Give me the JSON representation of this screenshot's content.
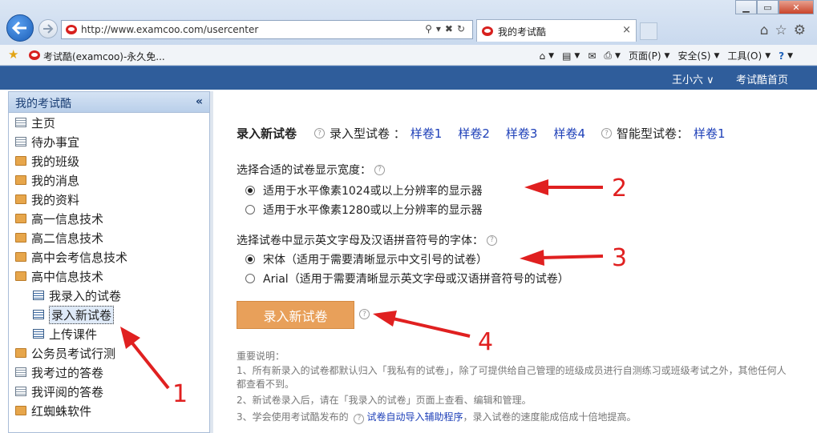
{
  "browser": {
    "url": "http://www.examcoo.com/usercenter",
    "tab_title": "我的考试酷",
    "tab_close": "×",
    "favorite_link": "考试酷(examcoo)-永久免...",
    "command_items": [
      {
        "label": "页面(P)"
      },
      {
        "label": "安全(S)"
      },
      {
        "label": "工具(O)"
      }
    ]
  },
  "header": {
    "user": "王小六 ∨",
    "home_link": "考试酷首页"
  },
  "sidebar": {
    "title": "我的考试酷",
    "collapse": "«",
    "items": [
      {
        "label": "主页",
        "icon": "page"
      },
      {
        "label": "待办事宜",
        "icon": "page"
      },
      {
        "label": "我的班级",
        "icon": "folder"
      },
      {
        "label": "我的消息",
        "icon": "folder"
      },
      {
        "label": "我的资料",
        "icon": "folder"
      },
      {
        "label": "高一信息技术",
        "icon": "folder"
      },
      {
        "label": "高二信息技术",
        "icon": "folder"
      },
      {
        "label": "高中会考信息技术",
        "icon": "folder"
      },
      {
        "label": "高中信息技术",
        "icon": "folder"
      },
      {
        "label": "我录入的试卷",
        "icon": "doc"
      },
      {
        "label": "录入新试卷",
        "icon": "doc"
      },
      {
        "label": "上传课件",
        "icon": "doc"
      },
      {
        "label": "公务员考试行测",
        "icon": "folder"
      },
      {
        "label": "我考过的答卷",
        "icon": "page"
      },
      {
        "label": "我评阅的答卷",
        "icon": "page"
      },
      {
        "label": "红蜘蛛软件",
        "icon": "folder"
      }
    ]
  },
  "main": {
    "title": "录入新试卷",
    "entry_type_label": "录入型试卷 ：",
    "entry_samples": [
      "样卷1",
      "样卷2",
      "样卷3",
      "样卷4"
    ],
    "smart_type_label": "智能型试卷：",
    "smart_samples": [
      "样卷1"
    ],
    "width_section": {
      "label": "选择合适的试卷显示宽度：",
      "options": [
        {
          "label": "适用于水平像素1024或以上分辨率的显示器",
          "checked": true
        },
        {
          "label": "适用于水平像素1280或以上分辨率的显示器",
          "checked": false
        }
      ]
    },
    "font_section": {
      "label": "选择试卷中显示英文字母及汉语拼音符号的字体：",
      "options": [
        {
          "label": "宋体（适用于需要清晰显示中文引号的试卷）",
          "checked": true
        },
        {
          "label": "Arial（适用于需要清晰显示英文字母或汉语拼音符号的试卷）",
          "checked": false
        }
      ]
    },
    "new_button": "录入新试卷",
    "notes_title": "重要说明：",
    "notes": [
      "1、所有新录入的试卷都默认归入「我私有的试卷」，除了可提供给自己管理的班级成员进行自测练习或班级考试之外，其他任何人都查看不到。",
      "2、新试卷录入后，请在「我录入的试卷」页面上查看、编辑和管理。",
      "3、学会使用考试酷发布的"
    ],
    "note3_link": "试卷自动导入辅助程序",
    "note3_tail": "，录入试卷的速度能成倍成十倍地提高。"
  },
  "annotations": [
    "1",
    "2",
    "3",
    "4"
  ],
  "colors": {
    "accent": "#2f5d9b",
    "button": "#e8a05a",
    "annotation": "#e02020",
    "link": "#1d3fb8"
  }
}
